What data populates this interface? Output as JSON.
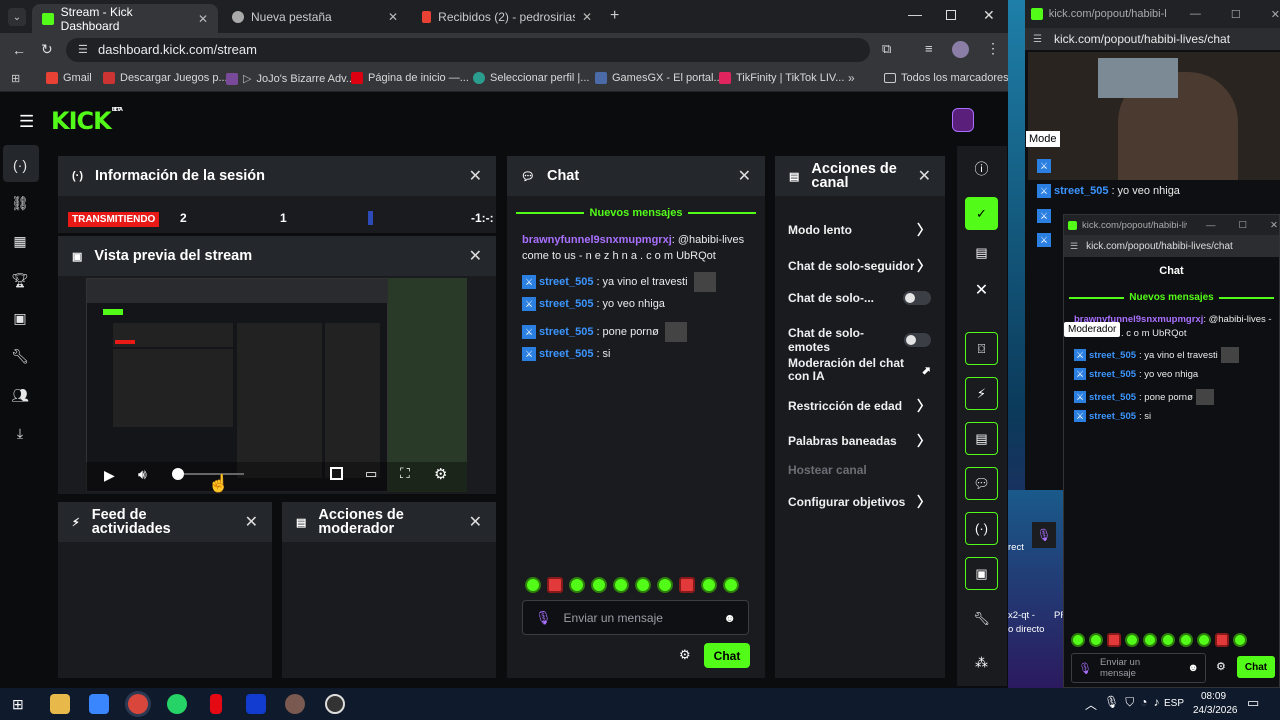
{
  "browser": {
    "tabs": [
      {
        "title": "Stream - Kick Dashboard"
      },
      {
        "title": "Nueva pestaña"
      },
      {
        "title": "Recibidos (2) - pedrosirias2017@"
      }
    ],
    "url": "dashboard.kick.com/stream",
    "bookmarks": [
      "Gmail",
      "Descargar Juegos p...",
      "JoJo's Bizarre Adv...",
      "Página de inicio —...",
      "Seleccionar perfil |...",
      "GamesGX - El portal...",
      "TikFinity | TikTok LIV...",
      "Todos los marcadores"
    ]
  },
  "kick": {
    "logo": "KICK",
    "logo_tag": "BETA",
    "session": {
      "title": "Información de la sesión",
      "status": "TRANSMITIENDO",
      "v1": "2",
      "v2": "1",
      "v3": "-1:-:"
    },
    "preview": {
      "title": "Vista previa del stream"
    },
    "feed": {
      "title": "Feed de actividades"
    },
    "modactions": {
      "title": "Acciones de moderador"
    },
    "chat": {
      "title": "Chat",
      "new_messages": "Nuevos mensajes",
      "first": {
        "user": "brawnyfunnel9snxmupmgrxj",
        "text": ": @habibi-lives come to us - n e z h n a . c o m UbRQot"
      },
      "messages": [
        {
          "user": "street_505",
          "text": ": ya vino el travesti"
        },
        {
          "user": "street_505",
          "text": ": yo veo nhiga"
        },
        {
          "user": "street_505",
          "text": ": pone pornø"
        },
        {
          "user": "street_505",
          "text": ": si"
        }
      ],
      "placeholder": "Enviar un mensaje",
      "send": "Chat"
    },
    "channel": {
      "title": "Acciones de canal",
      "items": [
        {
          "label": "Modo lento",
          "type": "chev"
        },
        {
          "label": "Chat de solo-seguidore",
          "type": "chev"
        },
        {
          "label": "Chat de solo-...",
          "type": "toggle"
        },
        {
          "label": "Chat de solo-emotes",
          "type": "toggle"
        },
        {
          "label": "Moderación del chat con IA",
          "type": "ext"
        },
        {
          "label": "Restricción de edad",
          "type": "chev"
        },
        {
          "label": "Palabras baneadas",
          "type": "chev"
        },
        {
          "label": "Hostear canal",
          "type": "disabled"
        },
        {
          "label": "Configurar objetivos",
          "type": "chev"
        }
      ]
    }
  },
  "popout": {
    "title": "kick.com/popout/habibi-liv...",
    "url": "kick.com/popout/habibi-lives/chat",
    "role": "Moderador",
    "role_short": "Mode",
    "left_lines": [
      {
        "user": "street_505",
        "text": ": yo veo nhiga"
      }
    ],
    "inner": {
      "title": "kick.com/popout/habibi-liv...",
      "url": "kick.com/popout/habibi-lives/chat",
      "header": "Chat",
      "new_messages": "Nuevos mensajes",
      "first": {
        "user": "brawnyfunnel9snxmupmgrxj",
        "text": ": @habibi-lives - n e z h n a . c o m UbRQot"
      },
      "messages": [
        {
          "user": "street_505",
          "text": ": ya vino el travesti"
        },
        {
          "user": "street_505",
          "text": ": yo veo nhiga"
        },
        {
          "user": "street_505",
          "text": ": pone pornø"
        },
        {
          "user": "street_505",
          "text": ": si"
        }
      ],
      "placeholder": "Enviar un mensaje",
      "send": "Chat"
    },
    "desk_labels": [
      "x2-qt -",
      "o directo",
      "PR",
      "rect"
    ]
  },
  "taskbar": {
    "lang": "ESP",
    "time": "08:09",
    "date": "24/3/2026"
  },
  "colors": {
    "accent": "#53fc18",
    "username": "#3c95ff",
    "panel": "#191b1f",
    "live": "#e91916",
    "purple": "#a970ff"
  }
}
